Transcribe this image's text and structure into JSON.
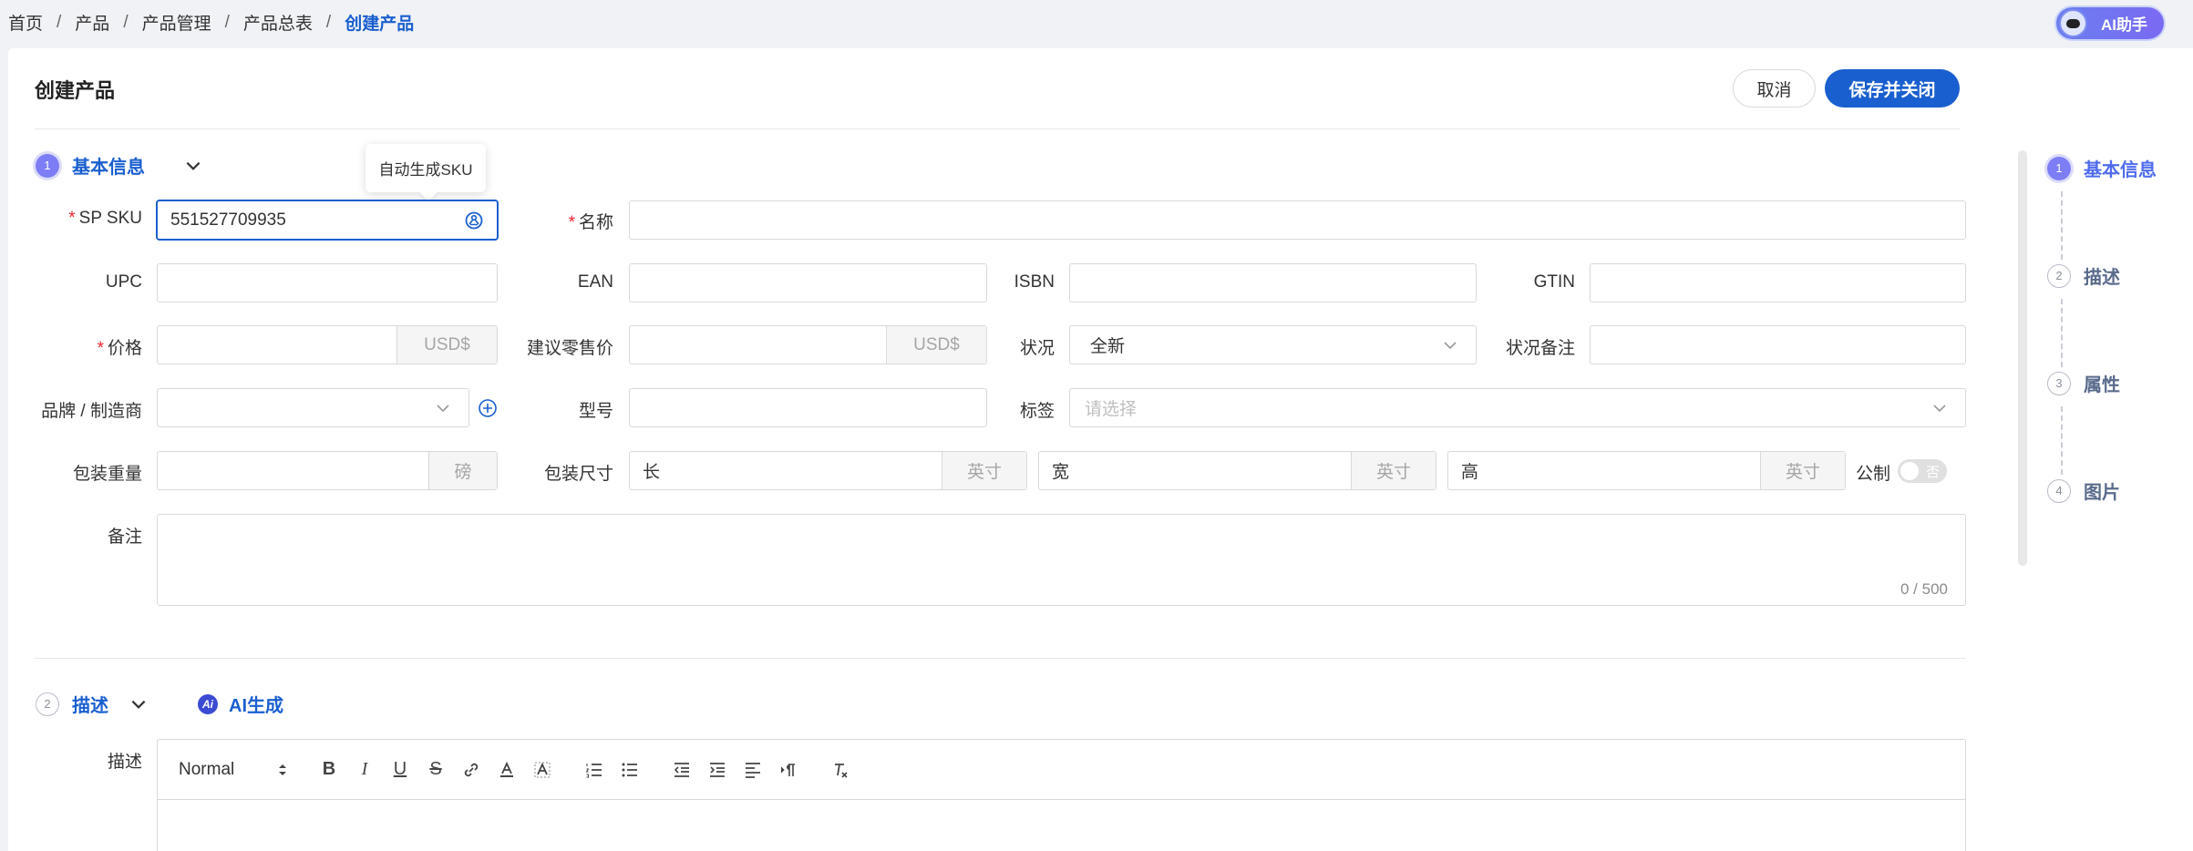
{
  "breadcrumb": [
    "首页",
    "产品",
    "产品管理",
    "产品总表",
    "创建产品"
  ],
  "ai_assistant_label": "AI助手",
  "page_title": "创建产品",
  "actions": {
    "cancel": "取消",
    "save_close": "保存并关闭"
  },
  "sections": {
    "basic": {
      "number": "1",
      "title": "基本信息"
    },
    "description": {
      "number": "2",
      "title": "描述",
      "ai_generate": "AI生成"
    }
  },
  "tooltip": "自动生成SKU",
  "form": {
    "sp_sku": {
      "label": "SP SKU",
      "value": "551527709935",
      "required": true
    },
    "name": {
      "label": "名称",
      "value": "",
      "required": true
    },
    "upc": {
      "label": "UPC",
      "value": ""
    },
    "ean": {
      "label": "EAN",
      "value": ""
    },
    "isbn": {
      "label": "ISBN",
      "value": ""
    },
    "gtin": {
      "label": "GTIN",
      "value": ""
    },
    "price": {
      "label": "价格",
      "value": "",
      "unit": "USD$",
      "required": true
    },
    "msrp": {
      "label": "建议零售价",
      "value": "",
      "unit": "USD$"
    },
    "condition": {
      "label": "状况",
      "value": "全新"
    },
    "condition_note": {
      "label": "状况备注",
      "value": ""
    },
    "brand": {
      "label": "品牌 / 制造商",
      "value": ""
    },
    "model": {
      "label": "型号",
      "value": ""
    },
    "tags": {
      "label": "标签",
      "placeholder": "请选择"
    },
    "weight": {
      "label": "包装重量",
      "value": "",
      "unit": "磅"
    },
    "dimensions": {
      "label": "包装尺寸",
      "length": {
        "value": "长",
        "unit": "英寸"
      },
      "width": {
        "value": "宽",
        "unit": "英寸"
      },
      "height": {
        "value": "高",
        "unit": "英寸"
      }
    },
    "metric": {
      "label": "公制",
      "toggle_text": "否",
      "on": false
    },
    "notes": {
      "label": "备注",
      "value": "",
      "counter": "0 / 500"
    },
    "description": {
      "label": "描述"
    }
  },
  "editor_toolbar": {
    "format_select": "Normal"
  },
  "steps": [
    {
      "number": "1",
      "label": "基本信息",
      "active": true
    },
    {
      "number": "2",
      "label": "描述",
      "active": false
    },
    {
      "number": "3",
      "label": "属性",
      "active": false
    },
    {
      "number": "4",
      "label": "图片",
      "active": false
    }
  ],
  "colors": {
    "primary": "#1a5fcf",
    "required": "#f5222d",
    "step_active": "#7d7ef5"
  }
}
